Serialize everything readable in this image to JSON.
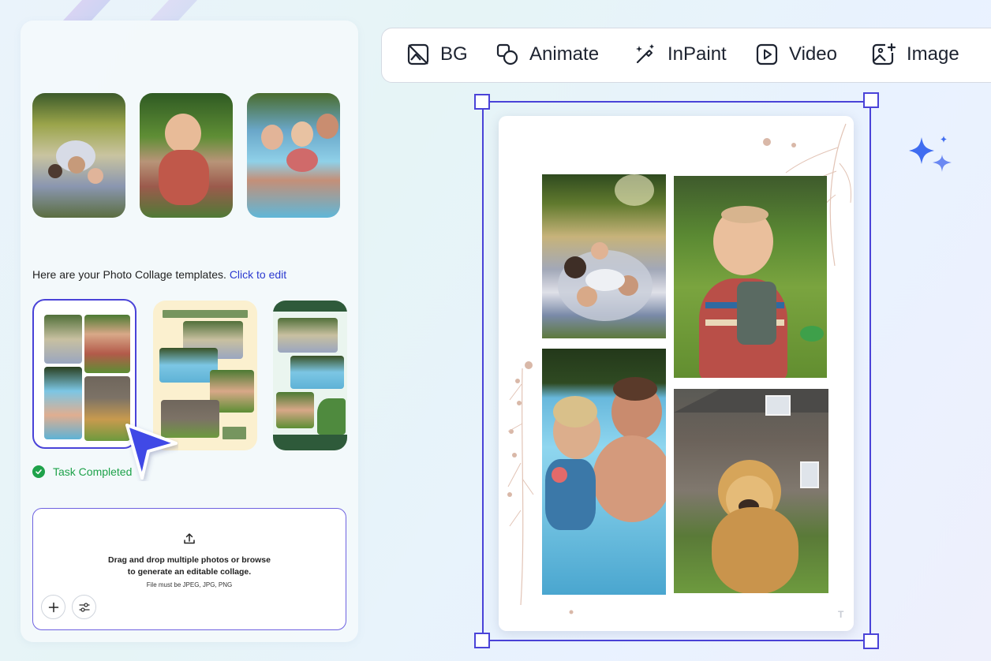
{
  "toolbar": {
    "items": [
      {
        "label": "BG",
        "icon": "remove-background-icon"
      },
      {
        "label": "Animate",
        "icon": "animate-icon"
      },
      {
        "label": "InPaint",
        "icon": "magic-wand-icon"
      },
      {
        "label": "Video",
        "icon": "video-play-icon"
      },
      {
        "label": "Image",
        "icon": "image-add-icon"
      }
    ]
  },
  "panel": {
    "instruction": "Here are your Photo Collage templates.",
    "instruction_link": "Click to edit",
    "status": "Task Completed",
    "upload": {
      "line1": "Drag and drop multiple photos or browse",
      "line2": "to generate an editable collage.",
      "note": "File must be JPEG, JPG, PNG"
    }
  },
  "colors": {
    "accent": "#4a43d8",
    "link": "#2c3ad0",
    "success": "#1ea24a",
    "sparkle": "#3f6cf0"
  }
}
